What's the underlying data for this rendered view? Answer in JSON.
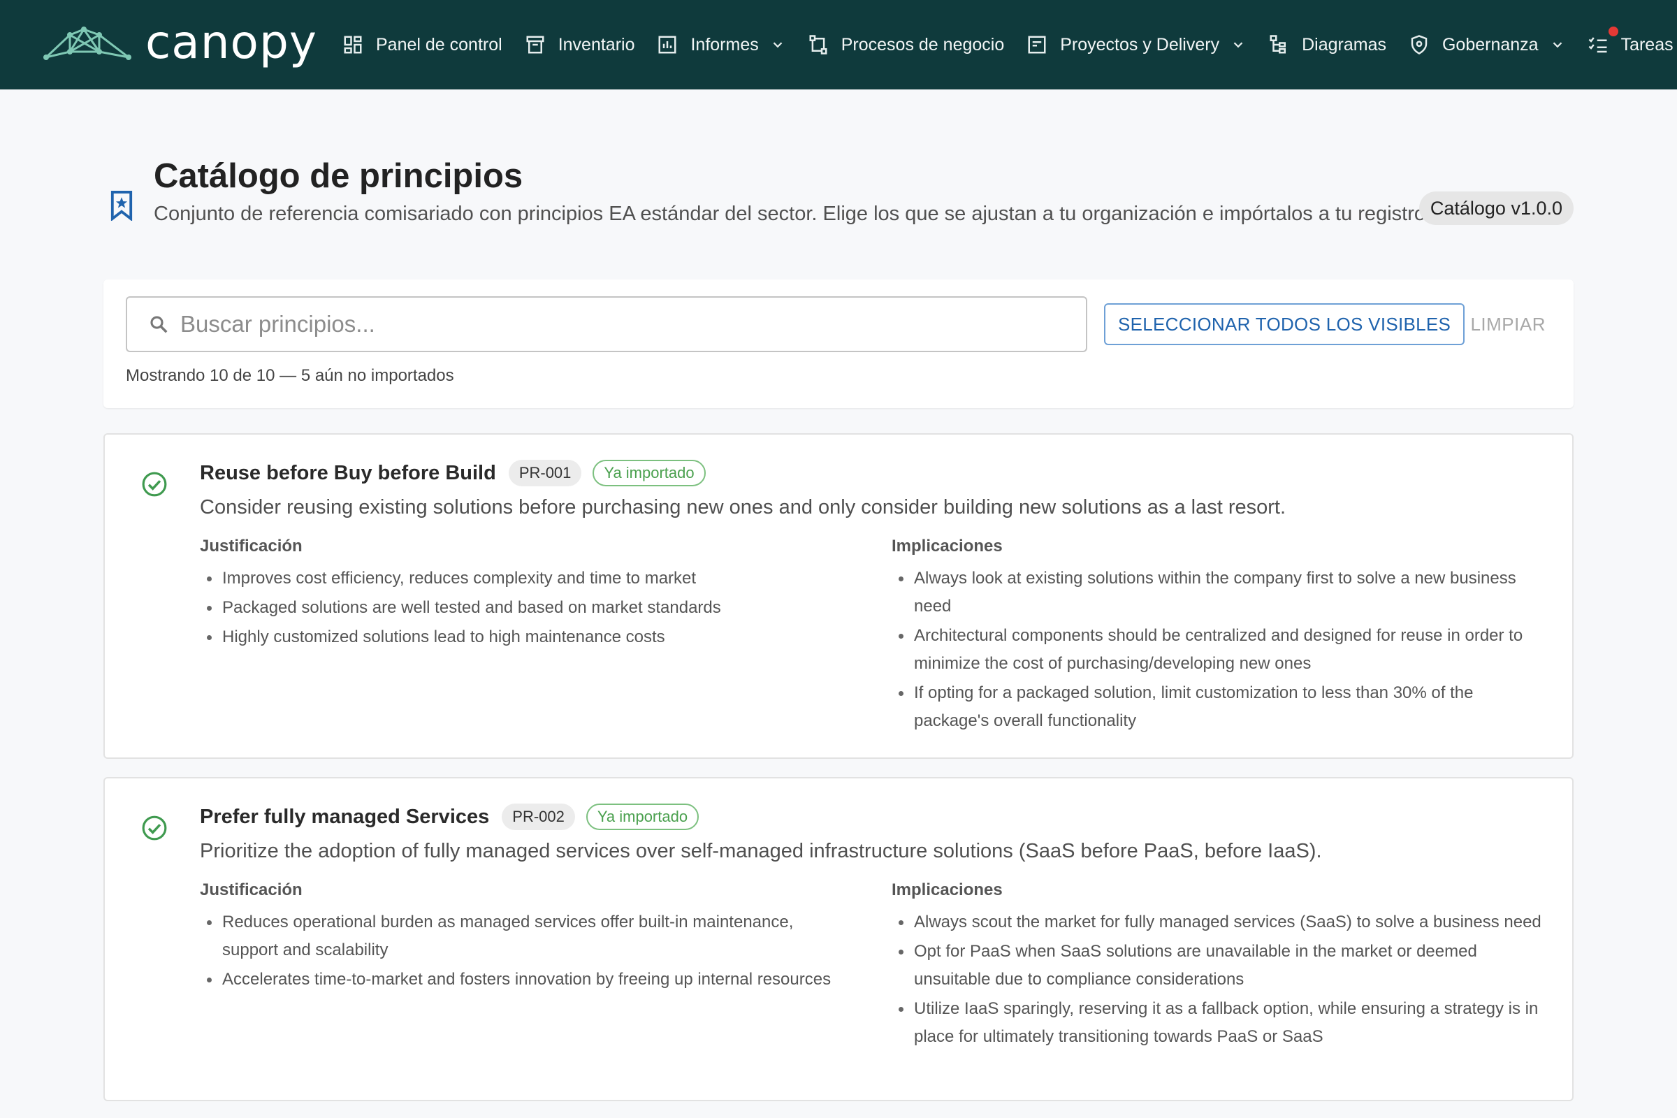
{
  "app": {
    "logo_text": "canopy"
  },
  "nav": {
    "items": [
      {
        "label": "Panel de control",
        "icon": "dashboard-icon"
      },
      {
        "label": "Inventario",
        "icon": "archive-icon"
      },
      {
        "label": "Informes",
        "icon": "bar-chart-icon",
        "has_dropdown": true
      },
      {
        "label": "Procesos de negocio",
        "icon": "process-icon"
      },
      {
        "label": "Proyectos y Delivery",
        "icon": "project-icon",
        "has_dropdown": true
      },
      {
        "label": "Diagramas",
        "icon": "diagram-icon"
      },
      {
        "label": "Gobernanza",
        "icon": "shield-icon",
        "has_dropdown": true
      },
      {
        "label": "Tareas",
        "icon": "tasks-icon",
        "notification": true
      }
    ]
  },
  "page": {
    "title": "Catálogo de principios",
    "subtitle": "Conjunto de referencia comisariado con principios EA estándar del sector. Elige los que se ajustan a tu organización e impórtalos a tu registro.",
    "version": "Catálogo v1.0.0"
  },
  "search": {
    "placeholder": "Buscar principios...",
    "value": "",
    "select_all_label": "SELECCIONAR TODOS LOS VISIBLES",
    "clear_label": "LIMPIAR",
    "showing_text": "Mostrando 10 de 10 — 5 aún no importados"
  },
  "labels": {
    "justification": "Justificación",
    "implications": "Implicaciones"
  },
  "principles": [
    {
      "title": "Reuse before Buy before Build",
      "code": "PR-001",
      "status": "Ya importado",
      "description": "Consider reusing existing solutions before purchasing new ones and only consider building new solutions as a last resort.",
      "justification": [
        "Improves cost efficiency, reduces complexity and time to market",
        "Packaged solutions are well tested and based on market standards",
        "Highly customized solutions lead to high maintenance costs"
      ],
      "implications": [
        "Always look at existing solutions within the company first to solve a new business need",
        "Architectural components should be centralized and designed for reuse in order to minimize the cost of purchasing/developing new ones",
        "If opting for a packaged solution, limit customization to less than 30% of the package's overall functionality"
      ]
    },
    {
      "title": "Prefer fully managed Services",
      "code": "PR-002",
      "status": "Ya importado",
      "description": "Prioritize the adoption of fully managed services over self-managed infrastructure solutions (SaaS before PaaS, before IaaS).",
      "justification": [
        "Reduces operational burden as managed services offer built-in maintenance, support and scalability",
        "Accelerates time-to-market and fosters innovation by freeing up internal resources"
      ],
      "implications": [
        "Always scout the market for fully managed services (SaaS) to solve a business need",
        "Opt for PaaS when SaaS solutions are unavailable in the market or deemed unsuitable due to compliance considerations",
        "Utilize IaaS sparingly, reserving it as a fallback option, while ensuring a strategy is in place for ultimately transitioning towards PaaS or SaaS"
      ]
    }
  ],
  "colors": {
    "topbar": "#0f3a3c",
    "accent_blue": "#1f63ad",
    "success_green": "#4aa04e",
    "notification_red": "#e53935"
  }
}
